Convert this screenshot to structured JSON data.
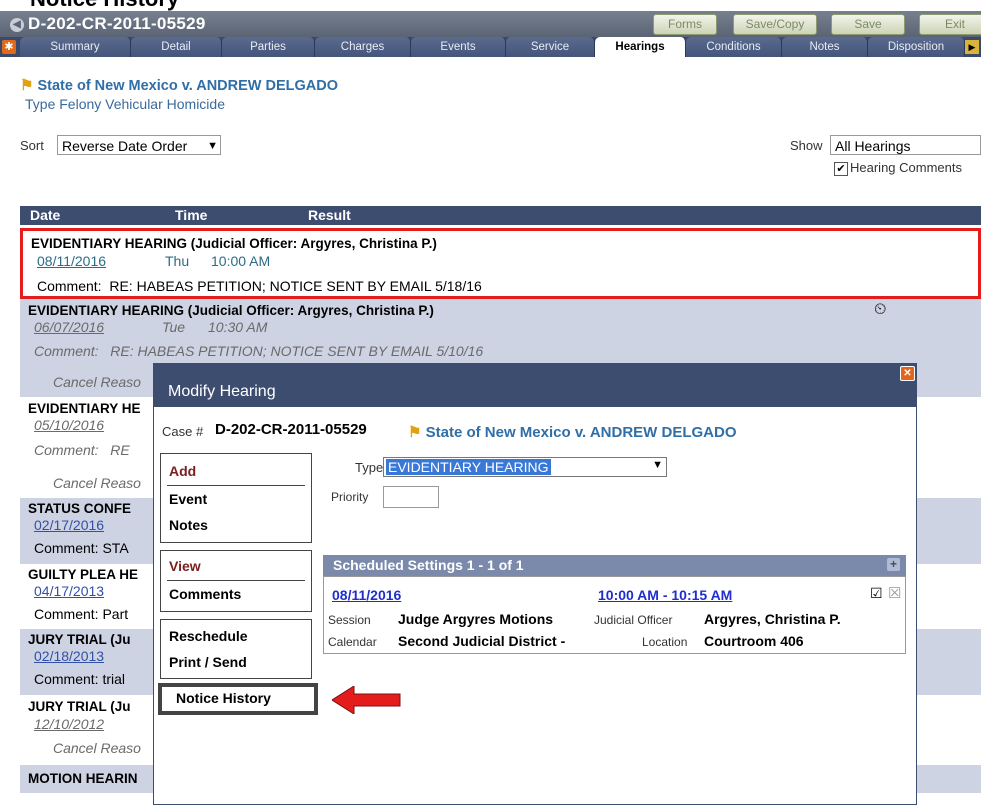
{
  "page_heading_cropped": "Notice History",
  "case": {
    "number": "D-202-CR-2011-05529",
    "caption": "State of New Mexico v. ANDREW DELGADO",
    "type_label": "Type",
    "type_value": "Felony Vehicular Homicide"
  },
  "toolbar": {
    "forms": "Forms",
    "save_copy": "Save/Copy",
    "save": "Save",
    "exit": "Exit"
  },
  "tabs": [
    "Summary",
    "Detail",
    "Parties",
    "Charges",
    "Events",
    "Service",
    "Hearings",
    "Conditions",
    "Notes",
    "Disposition"
  ],
  "active_tab": "Hearings",
  "sort": {
    "label": "Sort",
    "value": "Reverse Date Order"
  },
  "show": {
    "label": "Show",
    "value": "All Hearings",
    "checkbox_label": "Hearing Comments",
    "checked": true
  },
  "list_header": {
    "date": "Date",
    "time": "Time",
    "result": "Result"
  },
  "hearings": [
    {
      "name": "EVIDENTIARY HEARING (Judicial Officer: Argyres, Christina P.)",
      "date": "08/11/2016",
      "day": "Thu",
      "time": "10:00 AM",
      "comment_label": "Comment:",
      "comment": "RE: HABEAS PETITION; NOTICE SENT BY EMAIL 5/18/16"
    },
    {
      "name": "EVIDENTIARY HEARING (Judicial Officer: Argyres, Christina P.)",
      "date": "06/07/2016",
      "day": "Tue",
      "time": "10:30 AM",
      "comment_label": "Comment:",
      "comment": "RE: HABEAS PETITION; NOTICE SENT BY EMAIL 5/10/16",
      "cancel": "Cancel Reaso"
    },
    {
      "name": "EVIDENTIARY HE",
      "date": "05/10/2016",
      "comment_label": "Comment:",
      "comment": "RE",
      "cancel": "Cancel Reaso"
    },
    {
      "name": "STATUS CONFE",
      "date": "02/17/2016",
      "comment": "Comment:  STA"
    },
    {
      "name": "GUILTY PLEA HE",
      "date": "04/17/2013",
      "comment": "Comment:  Part"
    },
    {
      "name": "JURY TRIAL (Ju",
      "date": "02/18/2013",
      "comment": "Comment:  trial"
    },
    {
      "name": "JURY TRIAL (Ju",
      "date": "12/10/2012",
      "cancel": "Cancel Reaso"
    },
    {
      "name": "MOTION HEARIN"
    }
  ],
  "modal": {
    "title": "Modify Hearing",
    "case_label": "Case #",
    "case_number": "D-202-CR-2011-05529",
    "caption": "State of New Mexico v. ANDREW DELGADO",
    "type_label": "Type",
    "type_value": "EVIDENTIARY HEARING",
    "priority_label": "Priority",
    "priority_value": "",
    "sidebar": {
      "add": "Add",
      "event": "Event",
      "notes": "Notes",
      "view": "View",
      "comments": "Comments",
      "reschedule": "Reschedule",
      "print_send": "Print / Send",
      "notice_history": "Notice History"
    },
    "settings": {
      "header": "Scheduled Settings 1 - 1 of 1",
      "date": "08/11/2016",
      "time_range": "10:00 AM - 10:15 AM",
      "session_label": "Session",
      "session_value": "Judge Argyres Motions",
      "officer_label": "Judicial Officer",
      "officer_value": "Argyres, Christina P.",
      "calendar_label": "Calendar",
      "calendar_value": "Second Judicial District -",
      "location_label": "Location",
      "location_value": "Courtroom 406"
    }
  },
  "colors": {
    "header_bar": "#3d4d70",
    "highlight_red": "#e41c1c",
    "link_blue": "#2c3bb0",
    "caption_blue": "#2f6ea6"
  }
}
